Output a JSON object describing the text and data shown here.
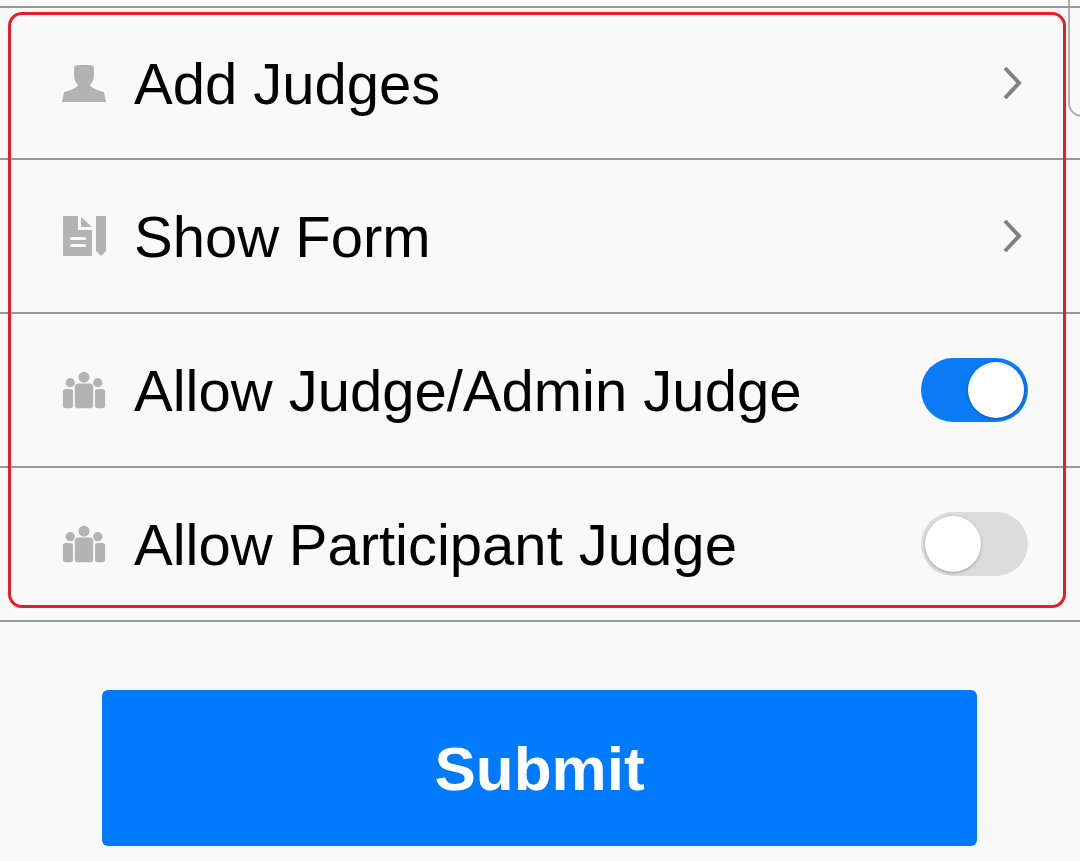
{
  "settings": [
    {
      "kind": "link",
      "label": "Add Judges"
    },
    {
      "kind": "link",
      "label": "Show Form"
    },
    {
      "kind": "toggle",
      "label": "Allow Judge/Admin Judge",
      "on": true
    },
    {
      "kind": "toggle",
      "label": "Allow Participant Judge",
      "on": false
    }
  ],
  "submit_button": {
    "label": "Submit"
  }
}
